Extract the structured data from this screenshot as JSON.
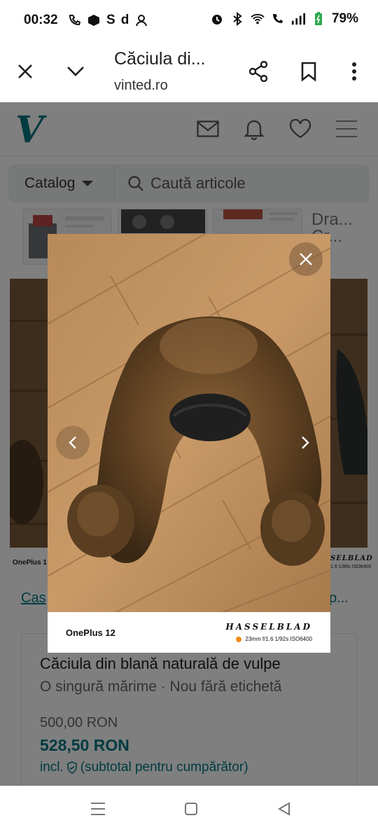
{
  "status_bar": {
    "time": "00:32",
    "left_glyphs": [
      "S",
      "d"
    ],
    "battery": "79%"
  },
  "browser": {
    "title": "Căciula di...",
    "domain": "vinted.ro",
    "icons": [
      "close-icon",
      "chevron-down-icon",
      "share-icon",
      "bookmark-icon",
      "more-vert-icon"
    ]
  },
  "vinted": {
    "logo": "V",
    "brand_color": "#007782",
    "header_icons": [
      "mail-icon",
      "bell-icon",
      "heart-icon",
      "menu-icon"
    ],
    "catalog_label": "Catalog",
    "search_placeholder": "Caută articole",
    "thumb_text": "Dra...\nCr...",
    "breadcrumb_start": "Cas",
    "breadcrumb_end": "p..."
  },
  "item": {
    "title": "Căciula din blană naturală de vulpe",
    "meta": "O singură mărime · Nou fără etichetă",
    "price": "500,00 RON",
    "total": "528,50 RON",
    "incl_prefix": "incl.",
    "incl_text": "(subtotal pentru cumpărător)"
  },
  "lightbox": {
    "phone": "OnePlus 12",
    "camera_brand": "HASSELBLAD",
    "specs": "23mm  f/1.6  1/92s  ISO6400",
    "bg_phone_left": "OnePlus 1",
    "bg_brand_right": "SELBLAD",
    "bg_specs_right": "1.6  1/89s  ISO6400",
    "icons": [
      "close-icon",
      "chevron-left-icon",
      "chevron-right-icon"
    ]
  },
  "nav_bar": {
    "icons": [
      "recents-icon",
      "home-icon",
      "back-icon"
    ]
  }
}
